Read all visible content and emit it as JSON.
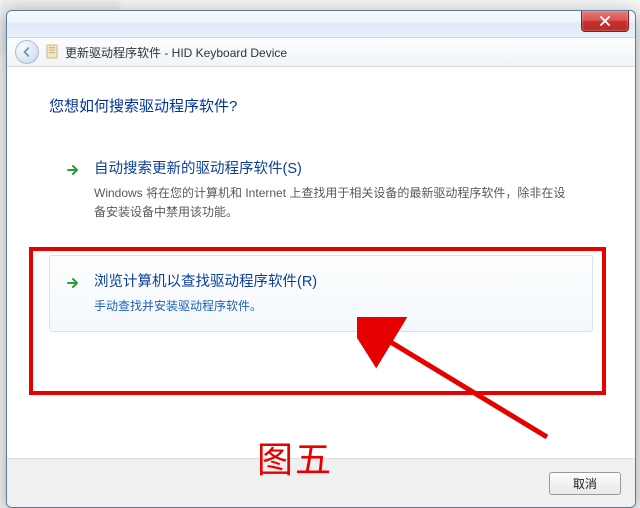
{
  "titlebar": {},
  "navbar": {
    "title": "更新驱动程序软件 - HID Keyboard Device"
  },
  "heading": "您想如何搜索驱动程序软件?",
  "options": [
    {
      "title": "自动搜索更新的驱动程序软件(S)",
      "desc": "Windows 将在您的计算机和 Internet 上查找用于相关设备的最新驱动程序软件，除非在设备安装设备中禁用该功能。"
    },
    {
      "title": "浏览计算机以查找驱动程序软件(R)",
      "desc": "手动查找并安装驱动程序软件。"
    }
  ],
  "footer": {
    "cancel": "取消"
  },
  "annotation": {
    "caption": "图五"
  },
  "colors": {
    "highlight": "#e60000",
    "link": "#0b3e9a"
  }
}
